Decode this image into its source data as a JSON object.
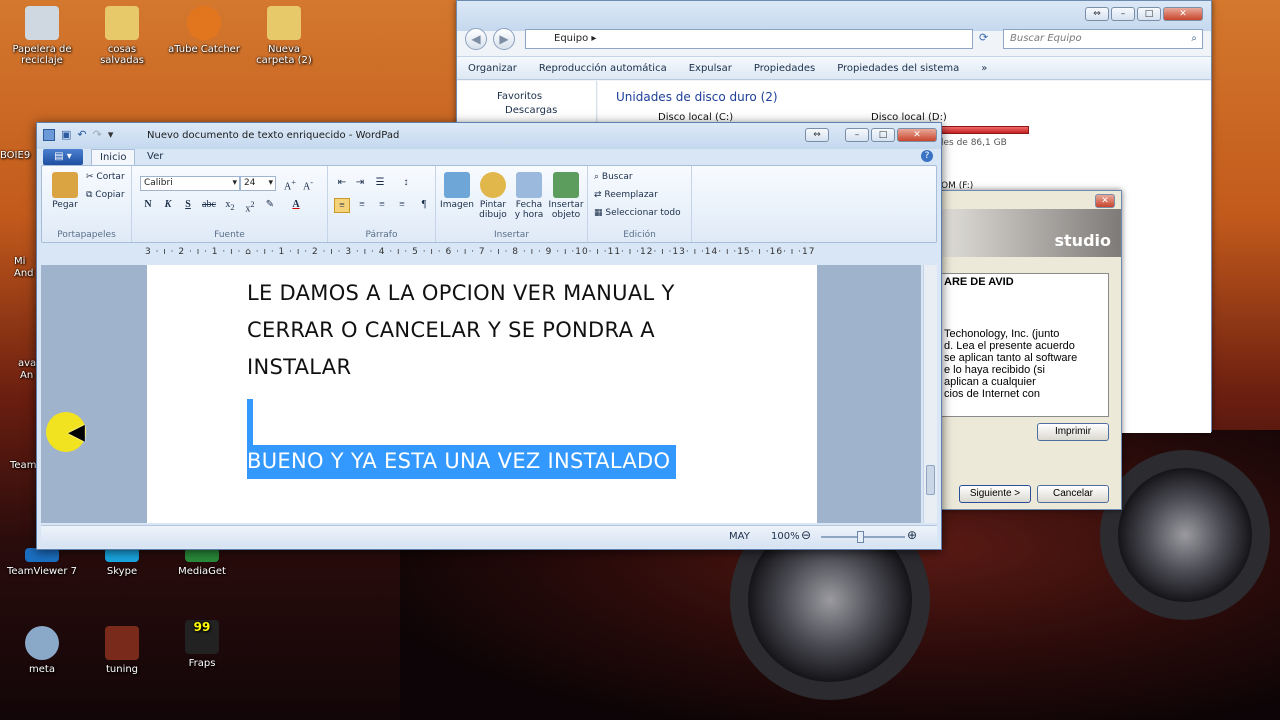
{
  "desktop": {
    "icons": [
      {
        "label": "Papelera de reciclaje",
        "color": "#cfd8e0"
      },
      {
        "label": "cosas salvadas",
        "color": "#e8c96a"
      },
      {
        "label": "aTube Catcher",
        "color": "#e2761e"
      },
      {
        "label": "Nueva carpeta (2)",
        "color": "#e8c96a"
      },
      {
        "label": "TeamViewer 7",
        "color": "#1b6fc2"
      },
      {
        "label": "Skype",
        "color": "#19a6e0"
      },
      {
        "label": "MediaGet",
        "color": "#2a8a3a"
      },
      {
        "label": "meta",
        "color": "#8aa8c8"
      },
      {
        "label": "tuning",
        "color": "#7a2a1a"
      },
      {
        "label": "Fraps",
        "color": "#222222"
      }
    ],
    "partial_labels": {
      "boie": "BOIE9",
      "mi": "Mi",
      "and": "And",
      "ava": "ava",
      "an": "An",
      "team": "Team"
    }
  },
  "explorer": {
    "address": "Equipo",
    "search_placeholder": "Buscar Equipo",
    "toolbar": [
      "Organizar",
      "Reproducción automática",
      "Expulsar",
      "Propiedades",
      "Propiedades del sistema",
      "»"
    ],
    "nav": [
      "Favoritos",
      "Descargas"
    ],
    "section": "Unidades de disco duro (2)",
    "drive_c": "Disco local (C:)",
    "drive_d": "Disco local (D:)",
    "drive_d_free": "les de 86,1 GB",
    "partial_drive": "OM (F:)"
  },
  "installer": {
    "logo": "studio",
    "license_heading": "ARE DE AVID",
    "license_lines": [
      "Techonology, Inc. (junto",
      "d. Lea el presente acuerdo",
      "se aplican tanto al software",
      "e lo haya recibido (si",
      "aplican a cualquier",
      "cios de Internet con"
    ],
    "print_button": "Imprimir",
    "next_button": "Siguiente >",
    "cancel_button": "Cancelar"
  },
  "wordpad": {
    "title": "Nuevo documento de texto enriquecido - WordPad",
    "tabs": [
      "Inicio",
      "Ver"
    ],
    "clipboard": {
      "paste": "Pegar",
      "cut": "Cortar",
      "copy": "Copiar",
      "label": "Portapapeles"
    },
    "font": {
      "family": "Calibri",
      "size": "24",
      "label": "Fuente",
      "bold": "N",
      "italic": "K",
      "underline": "S"
    },
    "paragraph_label": "Párrafo",
    "insert": {
      "image": "Imagen",
      "paint": "Pintar dibujo",
      "datetime": "Fecha y hora",
      "object": "Insertar objeto",
      "label": "Insertar"
    },
    "editing": {
      "find": "Buscar",
      "replace": "Reemplazar",
      "select_all": "Seleccionar todo",
      "label": "Edición"
    },
    "ruler": "3 · ı · 2 · ı · 1 · ı · ⌂ · ı · 1 · ı · 2 · ı · 3 · ı · 4 · ı · 5 · ı · 6 · ı · 7 · ı · 8 · ı · 9 · ı ·10· ı ·11· ı ·12· ı ·13· ı ·14· ı ·15· ı ·16· ı ·17· ı",
    "document": {
      "lines": [
        "LE DAMOS A LA OPCION VER MANUAL Y",
        "CERRAR O CANCELAR  Y SE PONDRA A",
        "INSTALAR"
      ],
      "selected_line": "BUENO Y YA ESTA UNA VEZ INSTALADO"
    },
    "status": {
      "caps": "MAY",
      "zoom": "100%"
    }
  }
}
